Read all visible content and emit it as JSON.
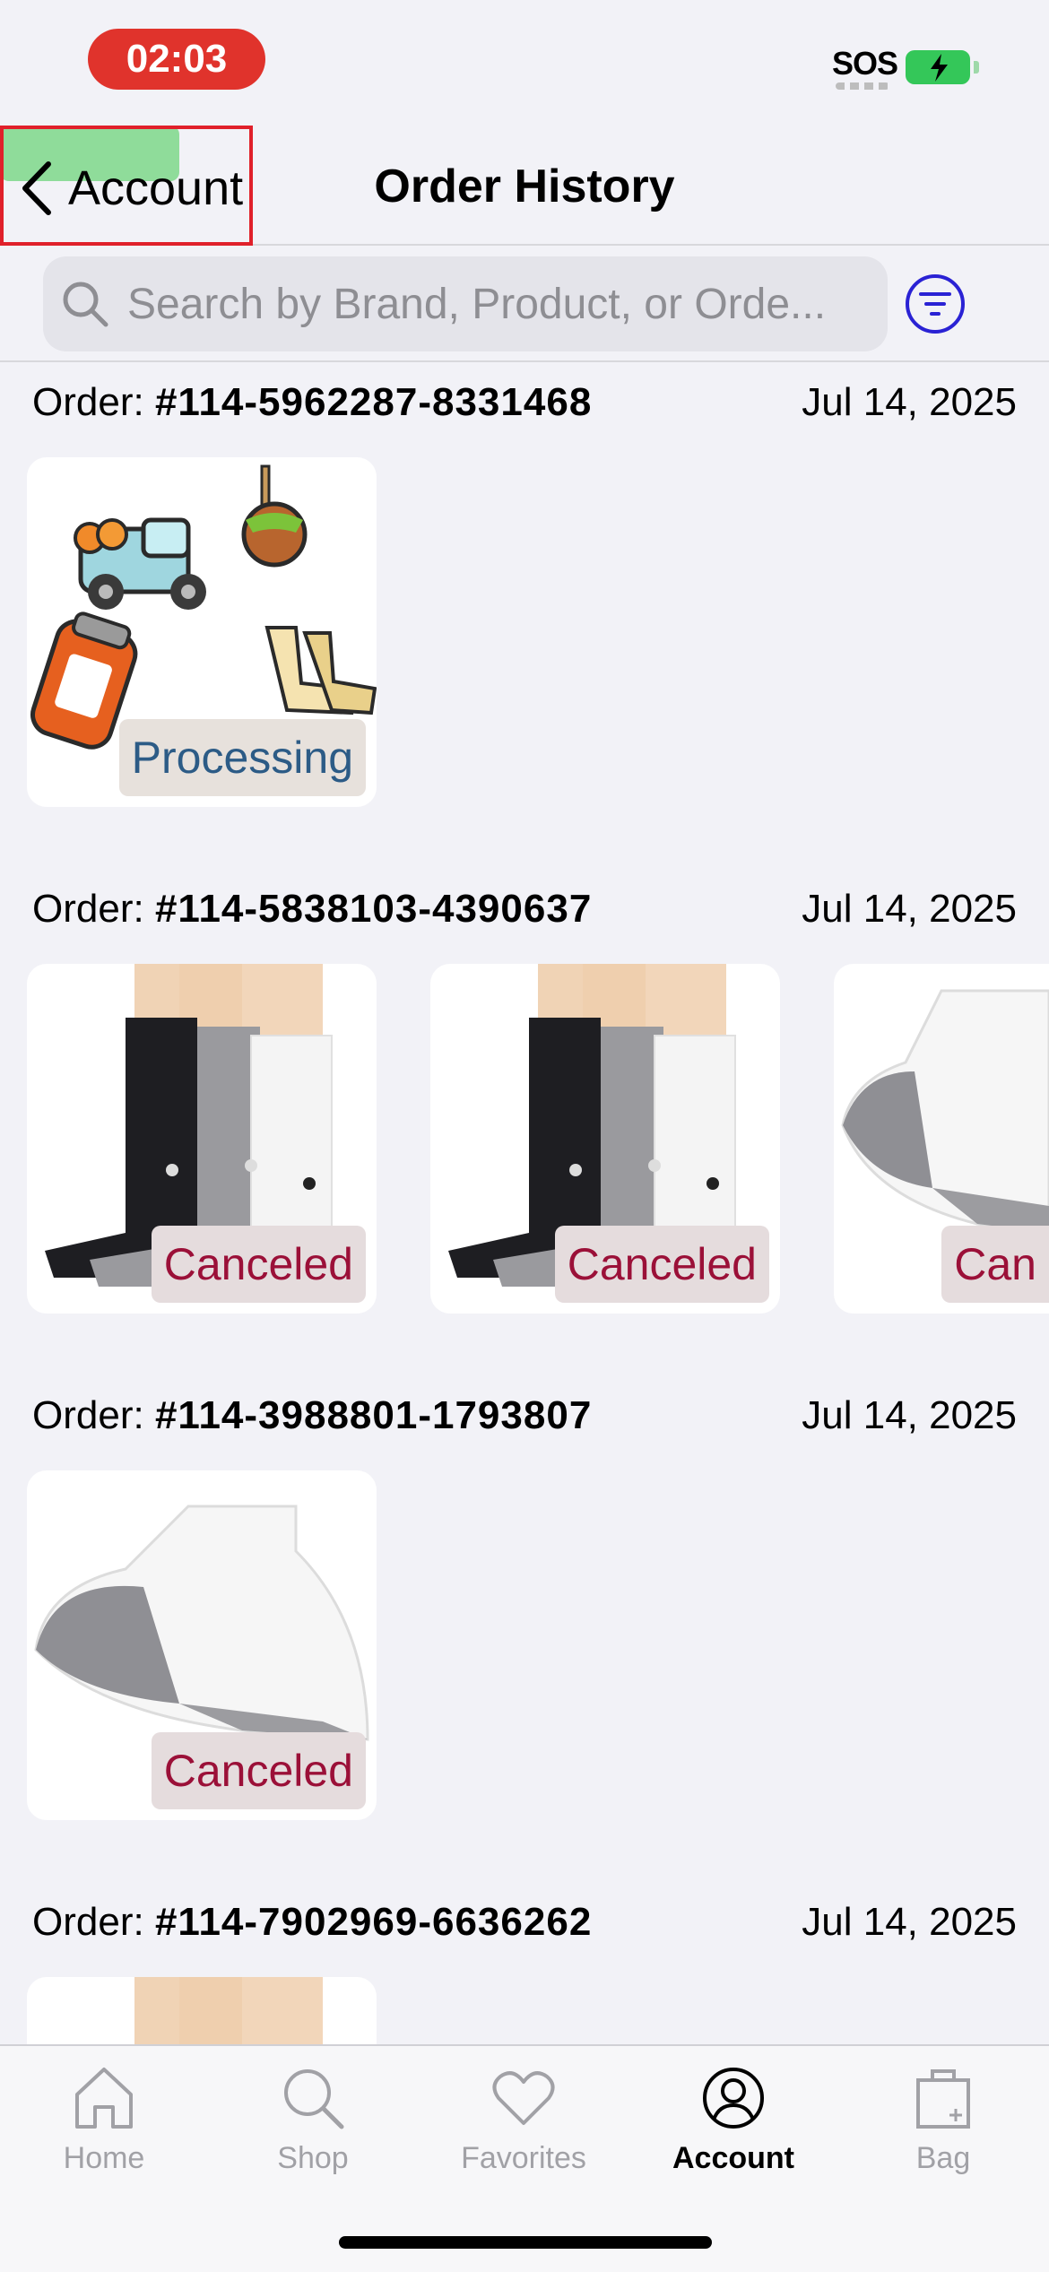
{
  "status_bar": {
    "time": "02:03",
    "sos": "SOS"
  },
  "nav": {
    "back_label": "Account",
    "title": "Order History"
  },
  "search": {
    "placeholder": "Search by Brand, Product, or Orde..."
  },
  "order_label": "Order:",
  "orders": [
    {
      "number": "#114-5962287-8331468",
      "date": "Jul 14, 2025",
      "items": [
        {
          "image": "charms-pack",
          "status": "Processing"
        }
      ]
    },
    {
      "number": "#114-5838103-4390637",
      "date": "Jul 14, 2025",
      "items": [
        {
          "image": "crew-socks-3pack",
          "status": "Canceled"
        },
        {
          "image": "crew-socks-3pack",
          "status": "Canceled"
        },
        {
          "image": "ankle-sock-white-gray",
          "status": "Can"
        }
      ]
    },
    {
      "number": "#114-3988801-1793807",
      "date": "Jul 14, 2025",
      "items": [
        {
          "image": "ankle-sock-white-gray",
          "status": "Canceled"
        }
      ]
    },
    {
      "number": "#114-7902969-6636262",
      "date": "Jul 14, 2025",
      "items": [
        {
          "image": "crew-socks-3pack",
          "status": ""
        }
      ]
    }
  ],
  "tabs": [
    {
      "label": "Home",
      "icon": "home-icon"
    },
    {
      "label": "Shop",
      "icon": "search-icon"
    },
    {
      "label": "Favorites",
      "icon": "heart-icon"
    },
    {
      "label": "Account",
      "icon": "account-icon",
      "active": true
    },
    {
      "label": "Bag",
      "icon": "bag-icon"
    }
  ],
  "colors": {
    "accent": "#2a22d4",
    "processing": "#2c5b86",
    "canceled": "#9b1038",
    "time_pill": "#e0332c"
  }
}
